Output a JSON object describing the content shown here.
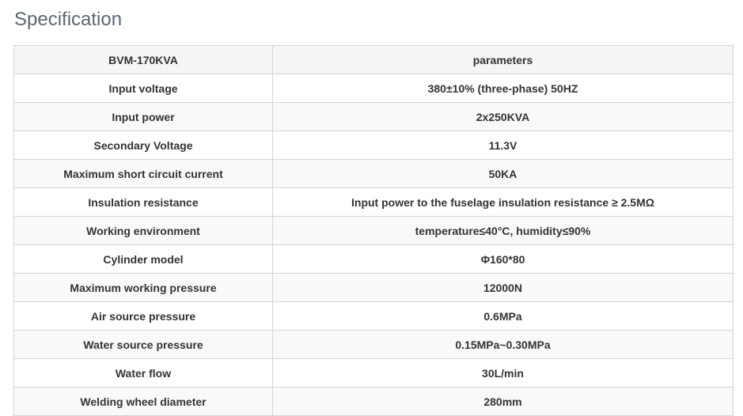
{
  "page": {
    "title": "Specification"
  },
  "table": {
    "headers": [
      "BVM-170KVA",
      "parameters"
    ],
    "rows": [
      [
        "Input voltage",
        "380±10% (three-phase) 50HZ"
      ],
      [
        "Input power",
        "2x250KVA"
      ],
      [
        "Secondary Voltage",
        "11.3V"
      ],
      [
        "Maximum short circuit current",
        "50KA"
      ],
      [
        "Insulation resistance",
        "Input power to the fuselage insulation resistance ≥ 2.5MΩ"
      ],
      [
        "Working environment",
        "temperature≤40°C, humidity≤90%"
      ],
      [
        "Cylinder model",
        "Φ160*80"
      ],
      [
        "Maximum working pressure",
        "12000N"
      ],
      [
        "Air source pressure",
        "0.6MPa"
      ],
      [
        "Water source pressure",
        "0.15MPa~0.30MPa"
      ],
      [
        "Water flow",
        "30L/min"
      ],
      [
        "Welding wheel diameter",
        "280mm"
      ]
    ]
  }
}
